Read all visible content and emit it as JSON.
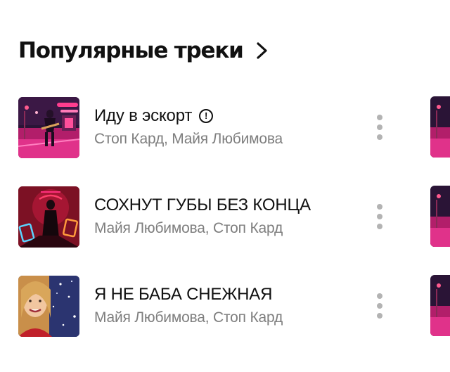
{
  "section": {
    "title": "Популярные треки",
    "chevron_icon": "chevron-right-icon"
  },
  "tracks": [
    {
      "title": "Иду в эскорт",
      "artists": "Стоп Кард, Майя Любимова",
      "explicit_mark": "!",
      "cover": "neon-street-cover",
      "more_icon": "more-vertical-icon"
    },
    {
      "title": "СОХНУТ ГУБЫ БЕЗ КОНЦА",
      "artists": "Майя Любимова, Стоп Кард",
      "cover": "neon-silhouette-cover",
      "more_icon": "more-vertical-icon"
    },
    {
      "title": "Я НЕ БАБА СНЕЖНАЯ",
      "artists": "Майя Любимова, Стоп Кард",
      "cover": "snow-portrait-cover",
      "more_icon": "more-vertical-icon"
    }
  ],
  "colors": {
    "title_text": "#111111",
    "secondary_text": "#7e7e7e",
    "more_dots": "#b3b3b3",
    "neon_pink": "#ff2f7d",
    "night_blue": "#1f2452"
  }
}
